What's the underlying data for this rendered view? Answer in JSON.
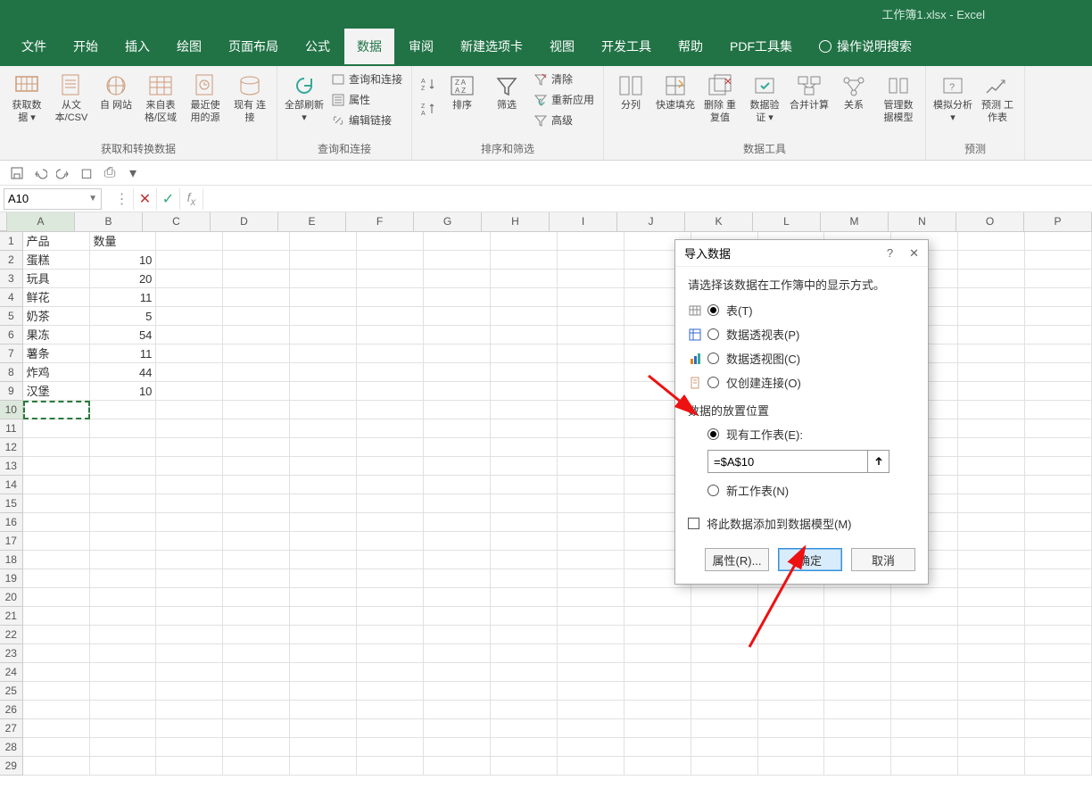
{
  "title": "工作簿1.xlsx  -  Excel",
  "tabs": [
    "文件",
    "开始",
    "插入",
    "绘图",
    "页面布局",
    "公式",
    "数据",
    "审阅",
    "新建选项卡",
    "视图",
    "开发工具",
    "帮助",
    "PDF工具集"
  ],
  "activeTab": 6,
  "helpSearch": "操作说明搜索",
  "ribbon": {
    "group1": {
      "label": "获取和转换数据",
      "btns": [
        "获取数\n据 ▾",
        "从文\n本/CSV",
        "自\n网站",
        "来自表\n格/区域",
        "最近使\n用的源",
        "现有\n连接"
      ]
    },
    "group2": {
      "label": "查询和连接",
      "refresh": "全部刷新\n▾",
      "items": [
        "查询和连接",
        "属性",
        "编辑链接"
      ]
    },
    "group3": {
      "label": "排序和筛选",
      "sort": "排序",
      "filter": "筛选",
      "az": "A↑Z",
      "za": "Z↓A",
      "items": [
        "清除",
        "重新应用",
        "高级"
      ]
    },
    "group4": {
      "label": "数据工具",
      "btns": [
        "分列",
        "快速填充",
        "删除\n重复值",
        "数据验\n证 ▾",
        "合并计算",
        "关系",
        "管理数\n据模型"
      ]
    },
    "group5": {
      "label": "预测",
      "btns": [
        "模拟分析\n▾",
        "预测\n工作表"
      ]
    }
  },
  "nameBox": "A10",
  "columns": [
    "A",
    "B",
    "C",
    "D",
    "E",
    "F",
    "G",
    "H",
    "I",
    "J",
    "K",
    "L",
    "M",
    "N",
    "O",
    "P"
  ],
  "rowCount": 29,
  "selectedRow": 10,
  "selectedCol": 0,
  "data": {
    "headers": [
      "产品",
      "数量"
    ],
    "rows": [
      [
        "蛋糕",
        "10"
      ],
      [
        "玩具",
        "20"
      ],
      [
        "鲜花",
        "11"
      ],
      [
        "奶茶",
        "5"
      ],
      [
        "果冻",
        "54"
      ],
      [
        "薯条",
        "11"
      ],
      [
        "炸鸡",
        "44"
      ],
      [
        "汉堡",
        "10"
      ]
    ]
  },
  "dialog": {
    "title": "导入数据",
    "prompt": "请选择该数据在工作簿中的显示方式。",
    "opt_table": "表(T)",
    "opt_pivot_table": "数据透视表(P)",
    "opt_pivot_chart": "数据透视图(C)",
    "opt_connection_only": "仅创建连接(O)",
    "section_placement": "数据的放置位置",
    "opt_existing": "现有工作表(E):",
    "ref_value": "=$A$10",
    "opt_new": "新工作表(N)",
    "chk_model": "将此数据添加到数据模型(M)",
    "btn_props": "属性(R)...",
    "btn_ok": "确定",
    "btn_cancel": "取消"
  }
}
